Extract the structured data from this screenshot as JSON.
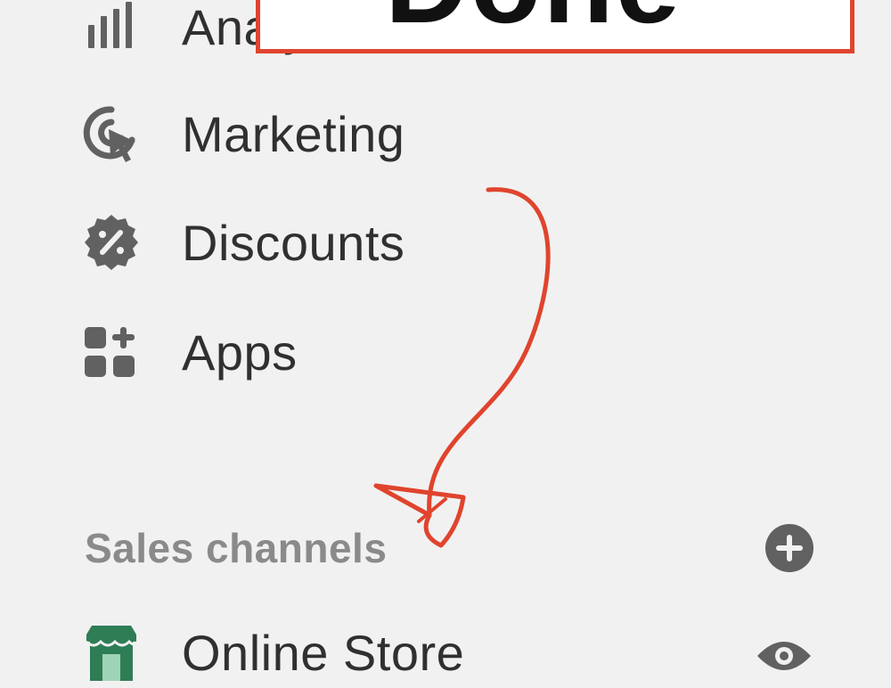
{
  "nav": {
    "items": [
      {
        "label": "Analytics",
        "icon": "bar-chart-icon"
      },
      {
        "label": "Marketing",
        "icon": "target-cursor-icon"
      },
      {
        "label": "Discounts",
        "icon": "discount-badge-icon"
      },
      {
        "label": "Apps",
        "icon": "apps-grid-icon"
      }
    ]
  },
  "sales_channels": {
    "title": "Sales channels",
    "add_icon": "plus-circle-icon",
    "items": [
      {
        "label": "Online Store",
        "icon": "storefront-icon",
        "action_icon": "eye-icon"
      }
    ]
  },
  "annotation": {
    "box_text": "Done",
    "color": "#e0442d"
  },
  "colors": {
    "background": "#f1f1f1",
    "text": "#303030",
    "muted": "#8a8a8a",
    "icon": "#616161",
    "store_green": "#2e7d55"
  }
}
